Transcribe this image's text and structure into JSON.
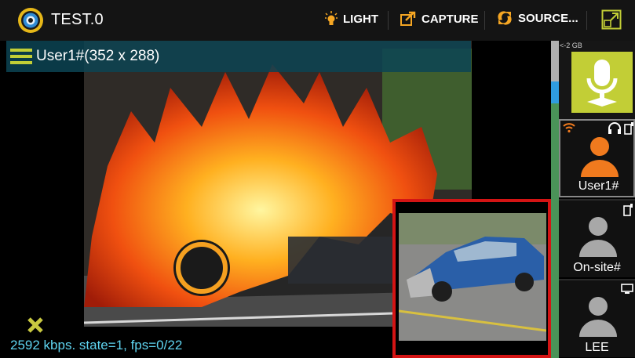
{
  "app": {
    "title": "TEST.0"
  },
  "toolbar": {
    "light_label": "LIGHT",
    "capture_label": "CAPTURE",
    "source_label": "SOURCE..."
  },
  "video": {
    "header_title": "User1#(352 x 288)",
    "stats": "2592 kbps. state=1, fps=0/22"
  },
  "side": {
    "storage": "<-2 GB",
    "users": [
      {
        "label": "User1#",
        "color": "#f07a1e",
        "icon": "headset-phone-icon"
      },
      {
        "label": "On-site#",
        "color": "#a8a8a8",
        "icon": "phone-icon"
      },
      {
        "label": "LEE",
        "color": "#a8a8a8",
        "icon": "monitor-icon"
      }
    ]
  },
  "colors": {
    "accent": "#c2ce36",
    "pip_border": "#d41414",
    "stats": "#5fd4f0",
    "header": "#0c4454"
  }
}
